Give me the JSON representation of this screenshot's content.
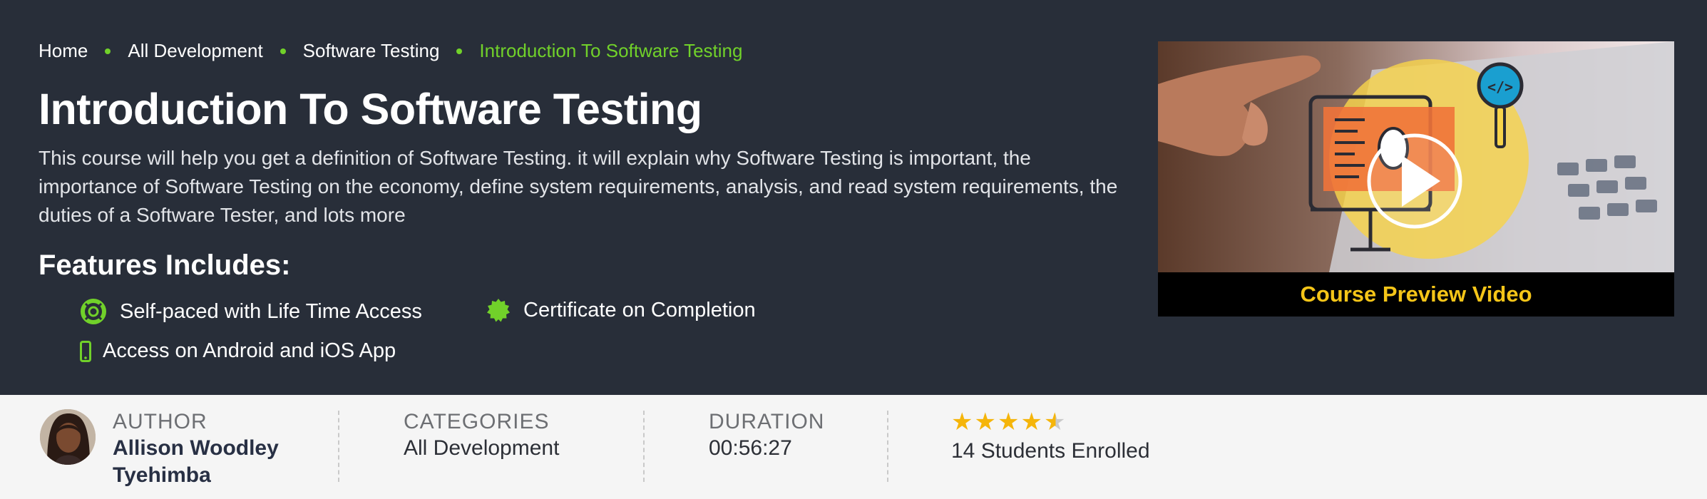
{
  "breadcrumb": {
    "home": "Home",
    "category": "All Development",
    "subcategory": "Software Testing",
    "current": "Introduction To Software Testing"
  },
  "course": {
    "title": "Introduction To Software Testing",
    "description": "This course will help you get a definition of Software Testing. it will explain why Software Testing is important, the importance of Software Testing on the economy, define system requirements, analysis, and read system requirements, the duties of a Software Tester, and lots more"
  },
  "features": {
    "heading": "Features Includes:",
    "items": [
      {
        "label": "Self-paced with Life Time Access",
        "icon": "lifebuoy-icon"
      },
      {
        "label": "Certificate on Completion",
        "icon": "certificate-badge-icon"
      },
      {
        "label": "Access on Android and iOS App",
        "icon": "mobile-phone-icon"
      }
    ]
  },
  "preview": {
    "caption": "Course Preview Video",
    "icon": "play-icon"
  },
  "meta": {
    "author_label": "AUTHOR",
    "author_name_line1": "Allison Woodley",
    "author_name_line2": "Tyehimba",
    "categories_label": "CATEGORIES",
    "categories_value": "All Development",
    "duration_label": "DURATION",
    "duration_value": "00:56:27",
    "rating": 4.5,
    "rating_max": 5,
    "enrolled": "14 Students Enrolled"
  },
  "colors": {
    "hero_bg": "#282e39",
    "accent_green": "#71d12a",
    "caption_yellow": "#f5c518",
    "star_gold": "#f5b50a"
  }
}
